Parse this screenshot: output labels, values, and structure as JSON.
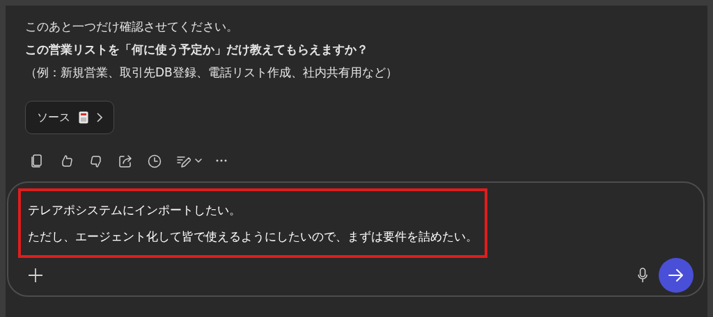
{
  "message": {
    "lines": [
      {
        "text": "このあと一つだけ確認させてください。",
        "kind": "normal"
      },
      {
        "text": "この営業リストを「何に使う予定か」だけ教えてもらえますか？",
        "kind": "bold"
      },
      {
        "text": "（例：新規営業、取引先DB登録、電話リスト作成、社内共有用など）",
        "kind": "normal"
      }
    ]
  },
  "source_button": {
    "label": "ソース"
  },
  "composer": {
    "value": [
      "テレアポシステムにインポートしたい。",
      "ただし、エージェント化して皆で使えるようにしたいので、まずは要件を詰めたい。"
    ],
    "highlighted": true
  }
}
